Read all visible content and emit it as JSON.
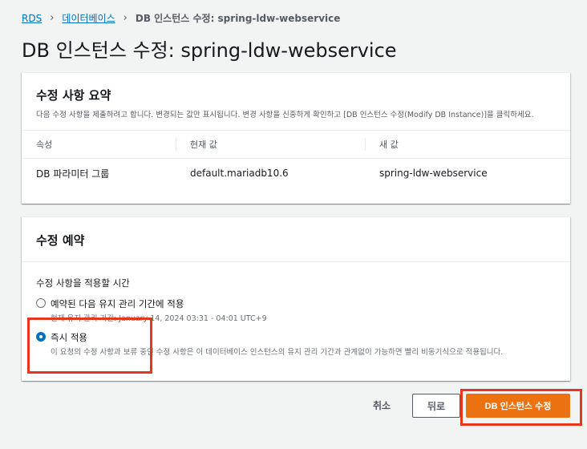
{
  "breadcrumb": {
    "items": [
      "RDS",
      "데이터베이스",
      "DB 인스턴스 수정: spring-ldw-webservice"
    ]
  },
  "page_title": "DB 인스턴스 수정: spring-ldw-webservice",
  "summary": {
    "title": "수정 사항 요약",
    "description": "다음 수정 사항을 제출하려고 합니다. 변경되는 값만 표시됩니다. 변경 사항을 신중하게 확인하고 [DB 인스턴스 수정(Modify DB Instance)]을 클릭하세요.",
    "columns": [
      "속성",
      "현재 값",
      "새 값"
    ],
    "rows": [
      [
        "DB 파라미터 그룹",
        "default.mariadb10.6",
        "spring-ldw-webservice"
      ]
    ]
  },
  "schedule": {
    "title": "수정 예약",
    "field_label": "수정 사항을 적용할 시간",
    "options": [
      {
        "label": "예약된 다음 유지 관리 기간에 적용",
        "description": "현재 유지 관리 기간: January 14, 2024 03:31 - 04:01 UTC+9",
        "selected": false
      },
      {
        "label": "즉시 적용",
        "description": "이 요청의 수정 사항과 보류 중인 수정 사항은 이 데이터베이스 인스턴스의 유지 관리 기간과 관계없이 가능하면 빨리 비동기식으로 적용됩니다.",
        "selected": true
      }
    ]
  },
  "actions": {
    "cancel": "취소",
    "back": "뒤로",
    "submit": "DB 인스턴스 수정"
  },
  "colors": {
    "primary": "#ec7211",
    "link": "#0073bb",
    "highlight": "#e8361e"
  }
}
